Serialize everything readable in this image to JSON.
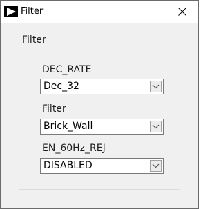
{
  "window": {
    "title": "Filter",
    "app_icon": "play-triangle-icon",
    "close_icon": "close-icon"
  },
  "group": {
    "legend": "Filter"
  },
  "fields": [
    {
      "label": "DEC_RATE",
      "value": "Dec_32"
    },
    {
      "label": "Filter",
      "value": "Brick_Wall"
    },
    {
      "label": "EN_60Hz_REJ",
      "value": "DISABLED"
    }
  ],
  "colors": {
    "background": "#f0f0f0",
    "titlebar": "#ffffff",
    "border": "#6b6b6b"
  }
}
